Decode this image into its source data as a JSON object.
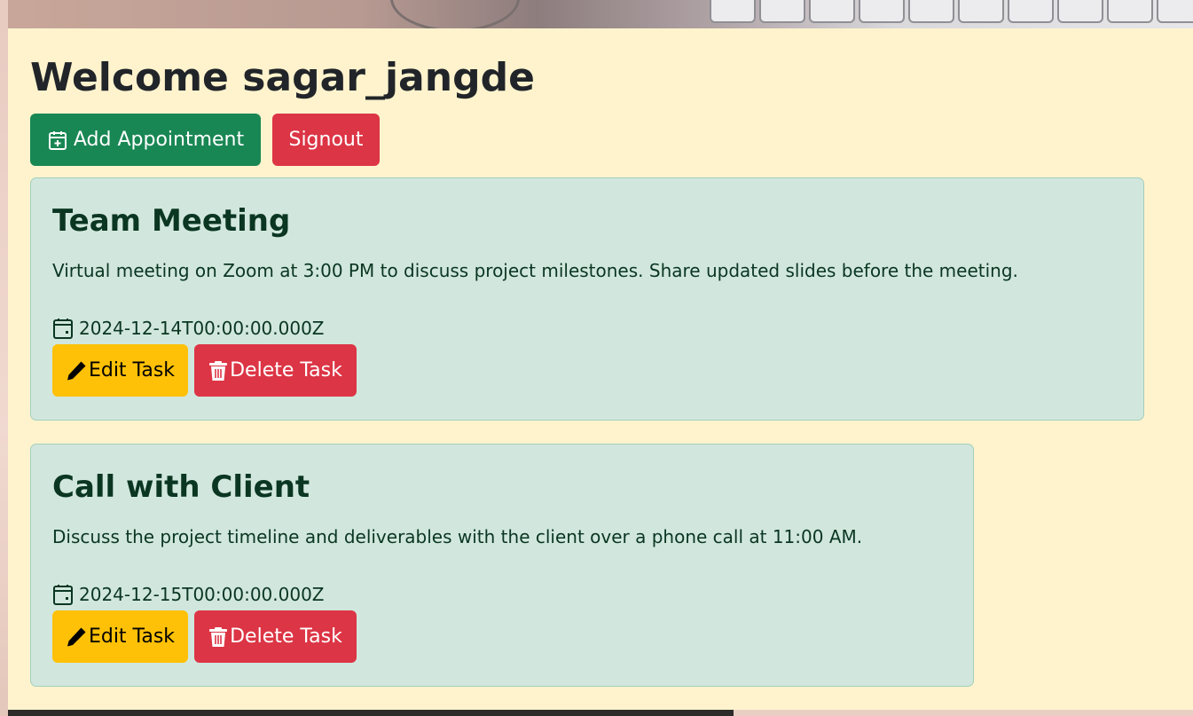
{
  "header": {
    "welcome_title": "Welcome sagar_jangde"
  },
  "toolbar": {
    "add_label": "Add Appointment",
    "signout_label": "Signout"
  },
  "tasks": [
    {
      "title": "Team Meeting",
      "description": "Virtual meeting on Zoom at 3:00 PM to discuss project milestones. Share updated slides before the meeting.",
      "date": "2024-12-14T00:00:00.000Z",
      "edit_label": "Edit Task",
      "delete_label": "Delete Task"
    },
    {
      "title": "Call with Client",
      "description": "Discuss the project timeline and deliverables with the client over a phone call at 11:00 AM.",
      "date": "2024-12-15T00:00:00.000Z",
      "edit_label": "Edit Task",
      "delete_label": "Delete Task"
    }
  ],
  "icons": {
    "add": "calendar-plus-icon",
    "date": "calendar-icon",
    "edit": "pencil-icon",
    "delete": "trash-icon"
  },
  "colors": {
    "page_background": "#fff3cd",
    "success": "#198754",
    "danger": "#dc3545",
    "warning": "#ffc107",
    "card_background": "#d1e7dd",
    "card_text": "#0a3622"
  }
}
